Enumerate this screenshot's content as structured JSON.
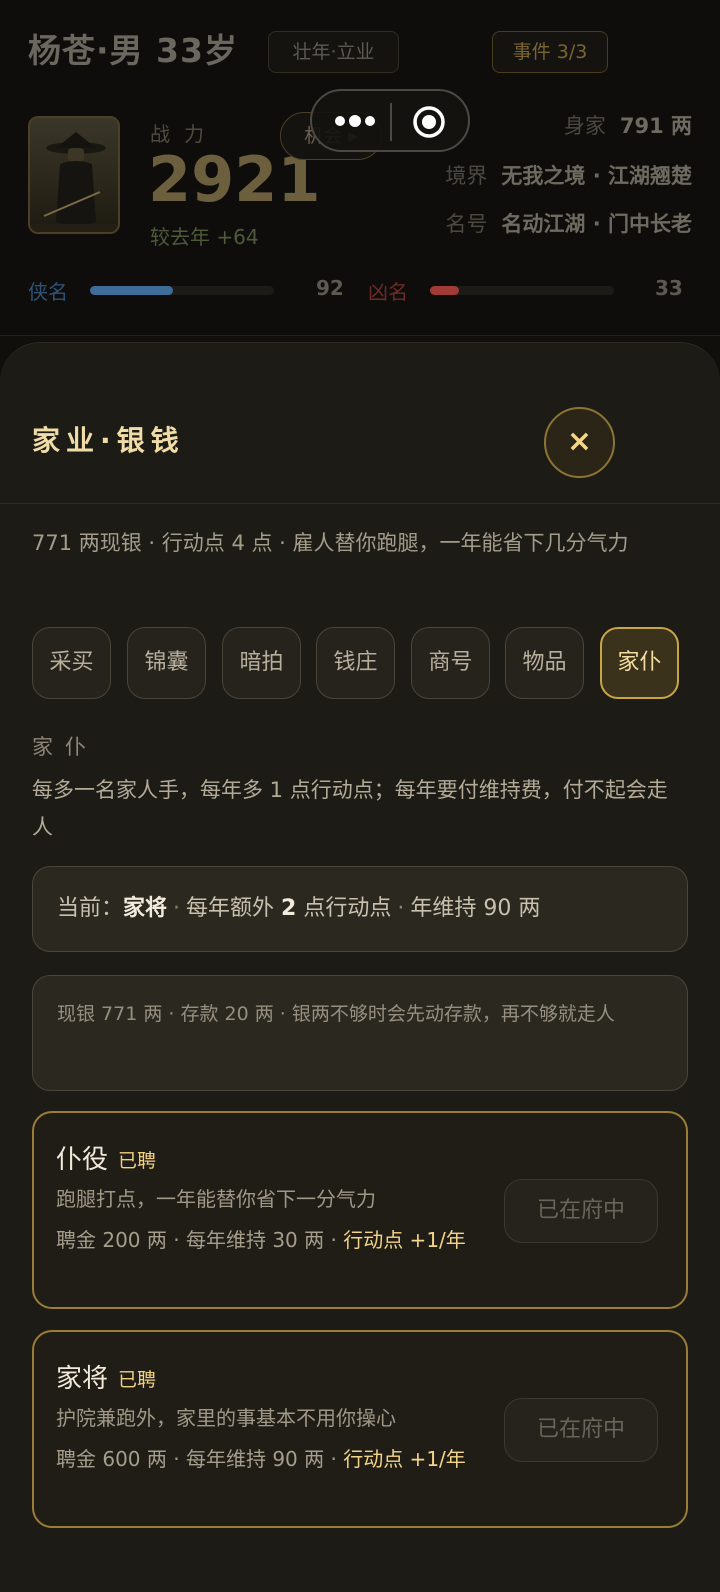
{
  "profile": {
    "name": "杨苍·男 33岁",
    "stage_tag": "壮年·立业",
    "event_tag": "事件 3/3",
    "power_label": "战力",
    "power_value": "2921",
    "power_delta": "较去年 +64",
    "chance_button": "机会 ▸",
    "wealth_label": "身家",
    "wealth_value": "791 两",
    "realm_label": "境界",
    "realm_value": "无我之境 · 江湖翘楚",
    "fame_label": "名号",
    "fame_value": "名动江湖 · 门中长老",
    "chivalry_label": "侠名",
    "chivalry_value": "92",
    "chivalry_fill": 0.45,
    "infamy_label": "凶名",
    "infamy_value": "33",
    "infamy_fill": 0.16
  },
  "colors": {
    "accent_gold": "#c8a545",
    "chivalry_bar": "#3e6d9a",
    "infamy_bar": "#a23b35"
  },
  "sheet": {
    "title": "家业·银钱",
    "close_icon": "×",
    "description": "771 两现银 · 行动点 4 点 · 雇人替你跑腿，一年能省下几分气力",
    "tabs": [
      "采买",
      "锦囊",
      "暗拍",
      "钱庄",
      "商号",
      "物品",
      "家仆"
    ],
    "active_tab": "家仆",
    "section_title": "家仆",
    "section_desc": "每多一名家人手，每年多 1 点行动点；每年要付维持费，付不起会走人",
    "current": {
      "prefix": "当前：",
      "servant": "家将",
      "bonus_pre": "每年额外 ",
      "bonus_num": "2",
      "bonus_post": " 点行动点",
      "upkeep": "年维持 90 两"
    },
    "note": "现银 771 两 · 存款 20 两 · 银两不够时会先动存款，再不够就走人",
    "cards": [
      {
        "name": "仆役",
        "badge": "已聘",
        "desc": "跑腿打点，一年能替你省下一分气力",
        "cost": "聘金 200 两 · 每年维持 30 两 · ",
        "bonus": "行动点 +1/年",
        "button": "已在府中"
      },
      {
        "name": "家将",
        "badge": "已聘",
        "desc": "护院兼跑外，家里的事基本不用你操心",
        "cost": "聘金 600 两 · 每年维持 90 两 · ",
        "bonus": "行动点 +1/年",
        "button": "已在府中"
      }
    ]
  },
  "icons": {
    "more": "more-dots-icon",
    "target": "target-icon",
    "close": "close-icon"
  }
}
